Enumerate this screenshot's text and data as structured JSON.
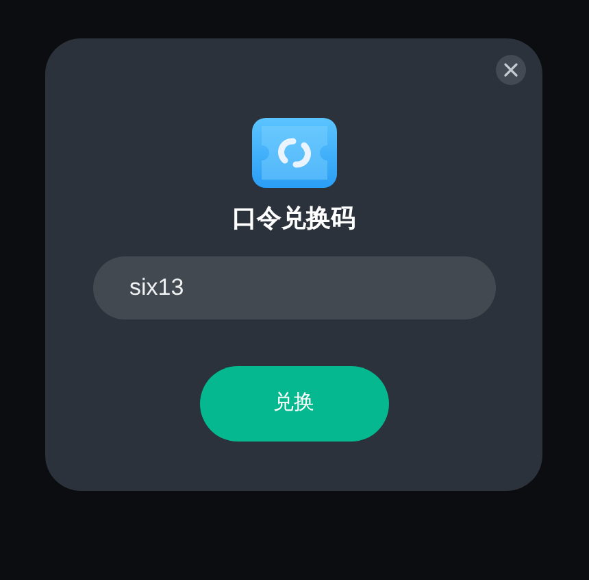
{
  "dialog": {
    "title": "口令兑换码",
    "code_field": {
      "value": "six13"
    },
    "confirm_button": {
      "label": "兑换"
    }
  }
}
